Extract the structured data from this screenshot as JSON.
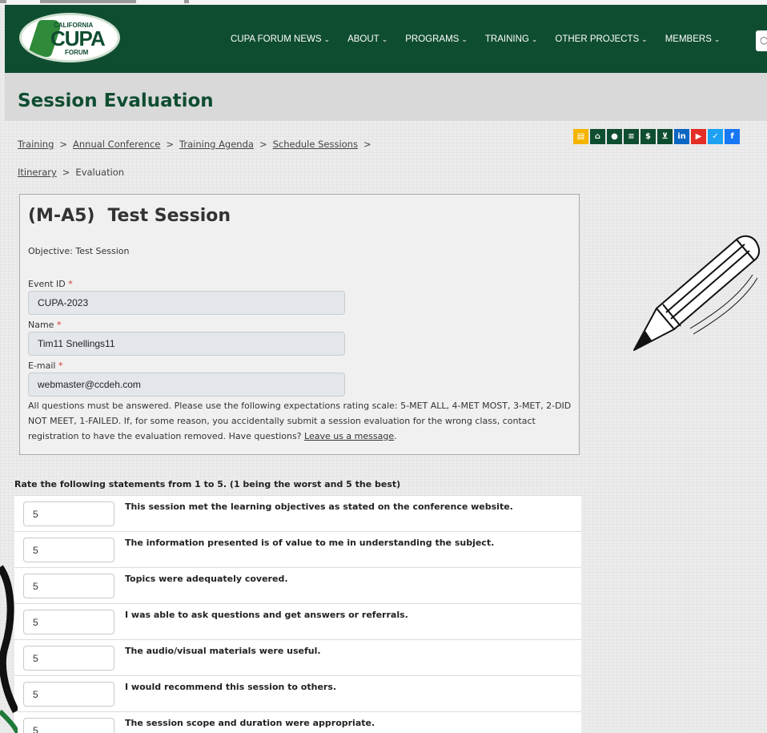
{
  "logo": {
    "top": "CALIFORNIA",
    "main": "CUPA",
    "bottom": "FORUM"
  },
  "nav": [
    {
      "label": "CUPA FORUM NEWS"
    },
    {
      "label": "ABOUT"
    },
    {
      "label": "PROGRAMS"
    },
    {
      "label": "TRAINING"
    },
    {
      "label": "OTHER PROJECTS"
    },
    {
      "label": "MEMBERS"
    }
  ],
  "page_title": "Session Evaluation",
  "breadcrumb": {
    "items": [
      "Training",
      "Annual Conference",
      "Training Agenda",
      "Schedule Sessions",
      "Itinerary"
    ],
    "current": "Evaluation",
    "separator": ">"
  },
  "social": [
    {
      "icon": "calendar-icon",
      "glyph": "▤",
      "color": "#f5b400"
    },
    {
      "icon": "home-icon",
      "glyph": "⌂",
      "color": "#0f4d31"
    },
    {
      "icon": "user-icon",
      "glyph": "●",
      "color": "#0f4d31"
    },
    {
      "icon": "list-icon",
      "glyph": "≡",
      "color": "#0f4d31"
    },
    {
      "icon": "dollar-icon",
      "glyph": "$",
      "color": "#0f4d31"
    },
    {
      "icon": "cart-icon",
      "glyph": "⊻",
      "color": "#0f4d31"
    },
    {
      "icon": "linkedin-icon",
      "glyph": "in",
      "color": "#0a66c2"
    },
    {
      "icon": "youtube-icon",
      "glyph": "▶",
      "color": "#e52d27"
    },
    {
      "icon": "twitter-icon",
      "glyph": "✓",
      "color": "#1da1f2"
    },
    {
      "icon": "facebook-icon",
      "glyph": "f",
      "color": "#1877f2"
    }
  ],
  "session": {
    "code": "(M-A5)",
    "title": "Test Session",
    "objective": "Objective: Test Session"
  },
  "fields": {
    "event_id": {
      "label": "Event ID",
      "required": "*",
      "value": "CUPA-2023"
    },
    "name": {
      "label": "Name",
      "required": "*",
      "value": "Tim11 Snellings11"
    },
    "email": {
      "label": "E-mail",
      "required": "*",
      "value": "webmaster@ccdeh.com"
    }
  },
  "instructions": {
    "text": "All questions must be answered. Please use the following expectations rating scale: 5-MET ALL, 4-MET MOST, 3-MET, 2-DID NOT MEET, 1-FAILED. If, for some reason, you accidentally submit a session evaluation for the wrong class, contact registration to have the evaluation removed. Have questions? ",
    "link": "Leave us a message",
    "end": "."
  },
  "rate_heading": "Rate the following statements from 1 to 5. (1 being the worst and 5 the best)",
  "ratings": [
    {
      "value": "5",
      "statement": "This session met the learning objectives as stated on the conference website."
    },
    {
      "value": "5",
      "statement": "The information presented is of value to me in understanding the subject."
    },
    {
      "value": "5",
      "statement": "Topics were adequately covered."
    },
    {
      "value": "5",
      "statement": "I was able to ask questions and get answers or referrals."
    },
    {
      "value": "5",
      "statement": "The audio/visual materials were useful."
    },
    {
      "value": "5",
      "statement": "I would recommend this session to others."
    },
    {
      "value": "5",
      "statement": "The session scope and duration were appropriate."
    }
  ],
  "colors": {
    "brand_green": "#0f4d31",
    "required": "#d9342b"
  }
}
